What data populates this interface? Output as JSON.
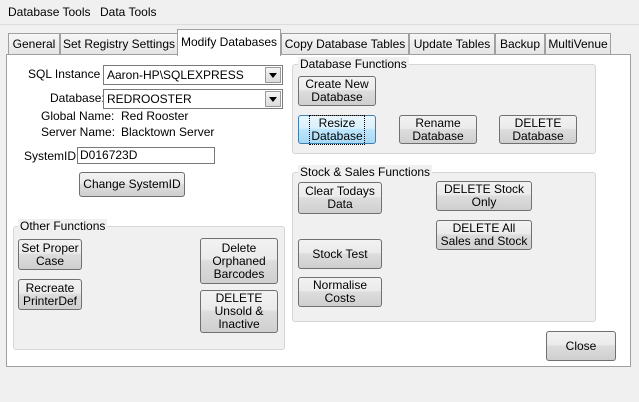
{
  "menu": {
    "items": [
      "Database Tools",
      "Data Tools"
    ]
  },
  "tabs": [
    "General",
    "Set Registry Settings",
    "Modify Databases",
    "Copy Database Tables",
    "Update Tables",
    "Backup",
    "MultiVenue"
  ],
  "form": {
    "sql_instance_label": "SQL Instance :",
    "sql_instance_value": "Aaron-HP\\SQLEXPRESS",
    "database_label": "Database:",
    "database_value": "REDROOSTER",
    "global_name_label": "Global Name:",
    "global_name_value": "Red Rooster",
    "server_name_label": "Server Name:",
    "server_name_value": "Blacktown Server",
    "system_id_label": "SystemID:",
    "system_id_value": "D016723D",
    "change_system_id_button": "Change SystemID"
  },
  "other_functions": {
    "title": "Other Functions",
    "set_proper_case": "Set Proper\nCase",
    "recreate_printerdef": "Recreate\nPrinterDef",
    "delete_orphaned_barcodes": "Delete\nOrphaned\nBarcodes",
    "delete_unsold_inactive": "DELETE\nUnsold &\nInactive"
  },
  "database_functions": {
    "title": "Database Functions",
    "create_new": "Create New\nDatabase",
    "resize": "Resize\nDatabase",
    "rename": "Rename\nDatabase",
    "delete": "DELETE\nDatabase"
  },
  "stock_sales_functions": {
    "title": "Stock & Sales Functions",
    "clear_todays_data": "Clear Todays\nData",
    "delete_stock_only": "DELETE Stock\nOnly",
    "delete_all_sales_stock": "DELETE All\nSales and Stock",
    "stock_test": "Stock Test",
    "normalise_costs": "Normalise\nCosts"
  },
  "footer": {
    "close_button": "Close"
  }
}
